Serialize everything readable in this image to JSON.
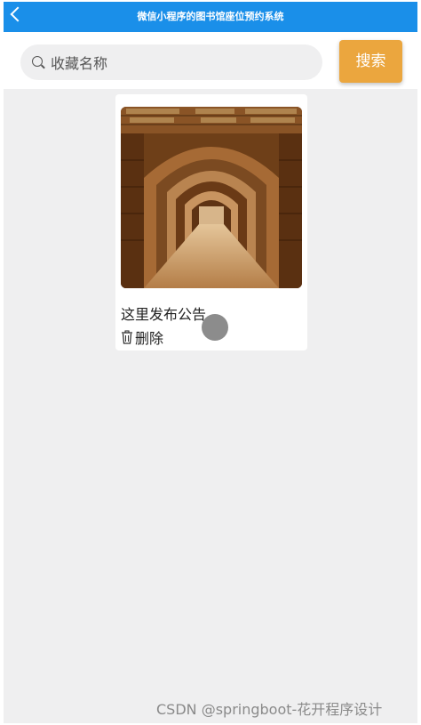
{
  "app": {
    "title": "微信小程序的图书馆座位预约系统",
    "accent_color": "#1a8fe9"
  },
  "search": {
    "placeholder": "收藏名称",
    "value": "",
    "button_label": "搜索",
    "button_color": "#eba63e"
  },
  "favorites": [
    {
      "title": "这里发布公告",
      "image_icon": "library-bookshelves-photo",
      "delete_label": "删除"
    }
  ],
  "watermark": "CSDN @springboot-花开程序设计"
}
